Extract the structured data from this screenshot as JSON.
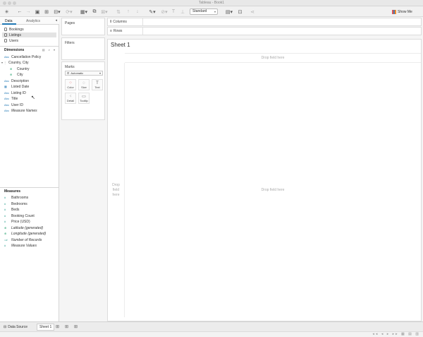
{
  "window": {
    "title": "Tableau - Book1"
  },
  "toolbar": {
    "view_select": "Standard",
    "show_me": "Show Me"
  },
  "data_pane": {
    "tabs": [
      "Data",
      "Analytics"
    ],
    "datasources": [
      {
        "label": "Bookings",
        "selected": false
      },
      {
        "label": "Listings",
        "selected": true
      },
      {
        "label": "Users",
        "selected": false
      }
    ],
    "dimensions_title": "Dimensions",
    "dimensions": [
      {
        "label": "Cancellation Policy",
        "icon": "Abc"
      },
      {
        "label": "Country, City",
        "icon": "hierarchy"
      },
      {
        "label": "Country",
        "icon": "globe"
      },
      {
        "label": "City",
        "icon": "globe"
      },
      {
        "label": "Description",
        "icon": "Abc"
      },
      {
        "label": "Listed Date",
        "icon": "calendar"
      },
      {
        "label": "Listing ID",
        "icon": "Abc"
      },
      {
        "label": "Title",
        "icon": "Abc"
      },
      {
        "label": "User ID",
        "icon": "Abc"
      },
      {
        "label": "Measure Names",
        "icon": "Abc"
      }
    ],
    "measures_title": "Measures",
    "measures": [
      {
        "label": "Bathrooms",
        "icon": "#"
      },
      {
        "label": "Bedrooms",
        "icon": "#"
      },
      {
        "label": "Beds",
        "icon": "#"
      },
      {
        "label": "Booking Count",
        "icon": "#"
      },
      {
        "label": "Price (USD)",
        "icon": "#"
      },
      {
        "label": "Latitude (generated)",
        "icon": "globe"
      },
      {
        "label": "Longitude (generated)",
        "icon": "globe"
      },
      {
        "label": "Number of Records",
        "icon": "=#"
      },
      {
        "label": "Measure Values",
        "icon": "#"
      }
    ]
  },
  "cards": {
    "pages": "Pages",
    "filters": "Filters",
    "marks": "Marks",
    "mark_type": "Automatic",
    "mark_buttons": [
      "Color",
      "Size",
      "Text",
      "Detail",
      "Tooltip"
    ]
  },
  "shelves": {
    "columns": "Columns",
    "rows": "Rows"
  },
  "canvas": {
    "sheet_title": "Sheet 1",
    "drop_top": "Drop field here",
    "drop_left": "Drop\nfield\nhere",
    "drop_main": "Drop field here"
  },
  "bottom_tabs": {
    "data_source": "Data Source",
    "sheet": "Sheet 1"
  }
}
